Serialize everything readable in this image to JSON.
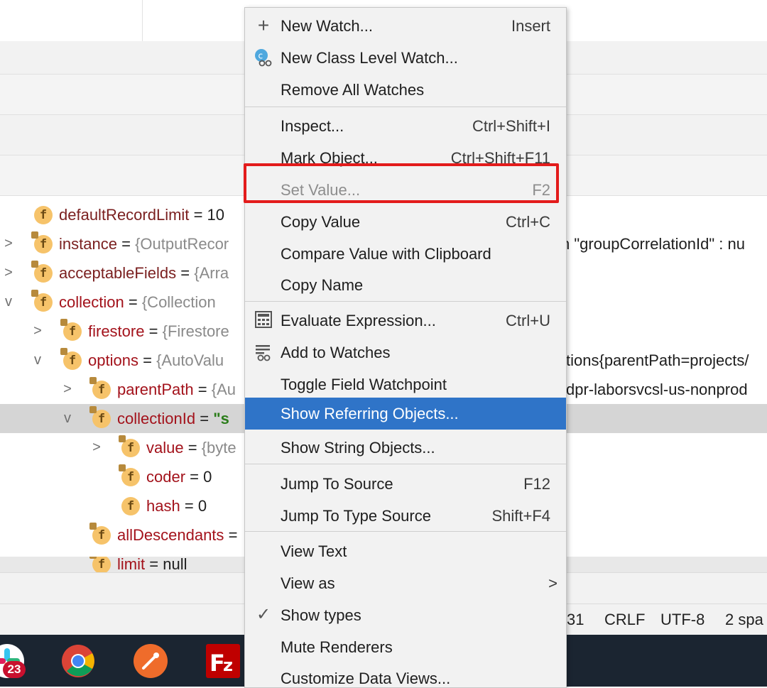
{
  "tree": {
    "rows": [
      {
        "name": "defaultRecordLimit",
        "value": "10",
        "arrow": ""
      },
      {
        "name": "instance",
        "value": "{OutputRecor",
        "arrow": ">",
        "tail": "n  \"groupCorrelationId\" : nu"
      },
      {
        "name": "acceptableFields",
        "value": "{Arra",
        "arrow": ">"
      },
      {
        "name": "collection",
        "value": "{Collection",
        "arrow": "v"
      },
      {
        "name": "firestore",
        "value": "{Firestore",
        "arrow": ">"
      },
      {
        "name": "options",
        "value": "{AutoValu",
        "arrow": "v",
        "tail": "tions{parentPath=projects/"
      },
      {
        "name": "parentPath",
        "value": "{Au",
        "arrow": ">",
        "tail": "dpr-laborsvcsl-us-nonprod"
      },
      {
        "name": "collectionId",
        "value": "\"s",
        "arrow": "v"
      },
      {
        "name": "value",
        "value": "{byte",
        "arrow": ">"
      },
      {
        "name": "coder",
        "value": "0",
        "arrow": ""
      },
      {
        "name": "hash",
        "value": "0",
        "arrow": ""
      },
      {
        "name": "allDescendants",
        "value": "",
        "arrow": ""
      },
      {
        "name": "limit",
        "value": "null",
        "arrow": ""
      }
    ],
    "eq": "="
  },
  "status": {
    "line": "31",
    "line_ending": "CRLF",
    "encoding": "UTF-8",
    "indent": "2 spa"
  },
  "taskbar": {
    "badge": "23"
  },
  "menu": {
    "items": [
      {
        "label": "New Watch...",
        "shortcut": "Insert"
      },
      {
        "label": "New Class Level Watch...",
        "shortcut": ""
      },
      {
        "label": "Remove All Watches",
        "shortcut": ""
      },
      {
        "label": "Inspect...",
        "shortcut": "Ctrl+Shift+I"
      },
      {
        "label": "Mark Object...",
        "shortcut": "Ctrl+Shift+F11"
      },
      {
        "label": "Set Value...",
        "shortcut": "F2"
      },
      {
        "label": "Copy Value",
        "shortcut": "Ctrl+C"
      },
      {
        "label": "Compare Value with Clipboard",
        "shortcut": ""
      },
      {
        "label": "Copy Name",
        "shortcut": ""
      },
      {
        "label": "Evaluate Expression...",
        "shortcut": "Ctrl+U"
      },
      {
        "label": "Add to Watches",
        "shortcut": ""
      },
      {
        "label": "Toggle Field Watchpoint",
        "shortcut": ""
      },
      {
        "label": "Show Referring Objects...",
        "shortcut": ""
      },
      {
        "label": "Show String Objects...",
        "shortcut": ""
      },
      {
        "label": "Jump To Source",
        "shortcut": "F12"
      },
      {
        "label": "Jump To Type Source",
        "shortcut": "Shift+F4"
      },
      {
        "label": "View Text",
        "shortcut": ""
      },
      {
        "label": "View as",
        "shortcut": ""
      },
      {
        "label": "Show types",
        "shortcut": ""
      },
      {
        "label": "Mute Renderers",
        "shortcut": ""
      },
      {
        "label": "Customize Data Views...",
        "shortcut": ""
      }
    ],
    "submenu_arrow": ">",
    "check": "✓",
    "plus": "+",
    "f_glyph": "f"
  },
  "colors": {
    "active_item": "#2f74c8",
    "highlight": "#e31b1b",
    "field_badge": "#f6c36a"
  }
}
